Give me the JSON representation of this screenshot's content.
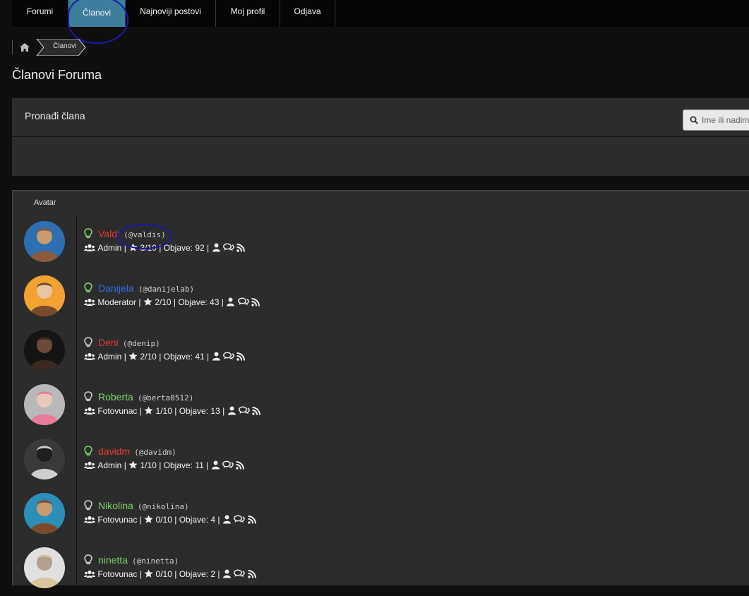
{
  "nav": {
    "items": [
      {
        "label": "Forumi"
      },
      {
        "label": "Članovi"
      },
      {
        "label": "Najnoviji postovi"
      },
      {
        "label": "Moj profil"
      },
      {
        "label": "Odjava"
      }
    ]
  },
  "breadcrumb": {
    "current": "Članovi"
  },
  "page": {
    "title": "Članovi Foruma"
  },
  "search": {
    "label": "Pronađi člana",
    "placeholder": "Ime ili nadimak"
  },
  "table": {
    "avatar_header": "Avatar"
  },
  "colors": {
    "admin_name": "#e53935",
    "moderator_name": "#2f6fe0",
    "member_name": "#7dcf6d",
    "online_bulb": "#7dcf6d",
    "offline_bulb": "#cccccc",
    "active_tab": "#3c7d9c"
  },
  "members": [
    {
      "name": "Valdi",
      "handle": "(@valdis)",
      "role": "Admin",
      "rank": "3/10",
      "posts_label": "Objave:",
      "posts": "92",
      "online": true,
      "name_color": "#e53935"
    },
    {
      "name": "Danijela",
      "handle": "(@danijelab)",
      "role": "Moderator",
      "rank": "2/10",
      "posts_label": "Objave:",
      "posts": "43",
      "online": true,
      "name_color": "#2f6fe0"
    },
    {
      "name": "Deni",
      "handle": "(@denip)",
      "role": "Admin",
      "rank": "2/10",
      "posts_label": "Objave:",
      "posts": "41",
      "online": false,
      "name_color": "#e53935"
    },
    {
      "name": "Roberta",
      "handle": "(@berta0512)",
      "role": "Fotovunac",
      "rank": "1/10",
      "posts_label": "Objave:",
      "posts": "13",
      "online": false,
      "name_color": "#7dcf6d"
    },
    {
      "name": "davidm",
      "handle": "(@davidm)",
      "role": "Admin",
      "rank": "1/10",
      "posts_label": "Objave:",
      "posts": "11",
      "online": true,
      "name_color": "#e53935"
    },
    {
      "name": "Nikolina",
      "handle": "(@nikolina)",
      "role": "Fotovunac",
      "rank": "0/10",
      "posts_label": "Objave:",
      "posts": "4",
      "online": false,
      "name_color": "#7dcf6d"
    },
    {
      "name": "ninetta",
      "handle": "(@ninetta)",
      "role": "Fotovunac",
      "rank": "0/10",
      "posts_label": "Objave:",
      "posts": "2",
      "online": false,
      "name_color": "#7dcf6d"
    }
  ]
}
